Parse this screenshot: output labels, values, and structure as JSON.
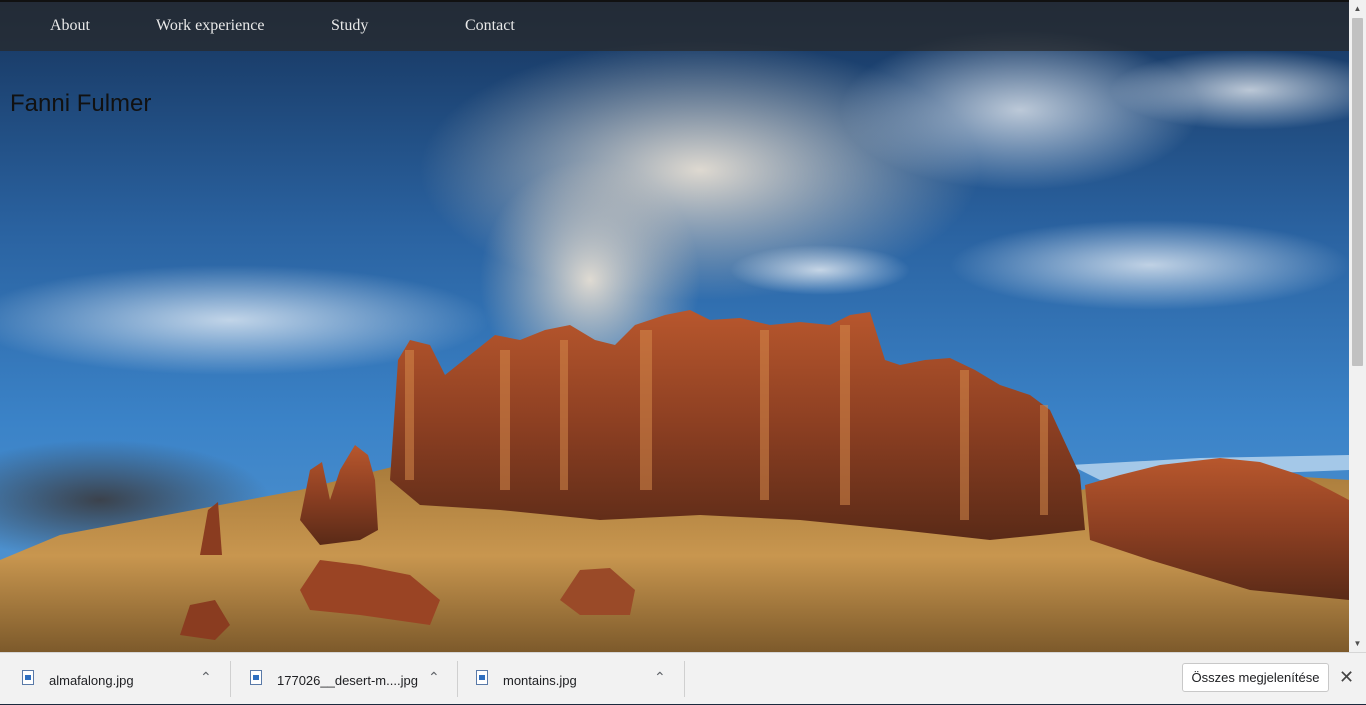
{
  "nav": {
    "items": [
      {
        "label": "About"
      },
      {
        "label": "Work experience"
      },
      {
        "label": "Study"
      },
      {
        "label": "Contact"
      }
    ]
  },
  "hero": {
    "title": "Fanni Fulmer"
  },
  "downloads": {
    "items": [
      {
        "name": "almafalong.jpg",
        "icon": "image-file-icon"
      },
      {
        "name": "177026__desert-m....jpg",
        "icon": "image-file-icon"
      },
      {
        "name": "montains.jpg",
        "icon": "image-file-icon"
      }
    ],
    "show_all_label": "Összes megjelenítése",
    "close_glyph": "✕",
    "chevron_glyph": "⌃"
  },
  "scrollbar": {
    "up_glyph": "▲",
    "down_glyph": "▼"
  }
}
